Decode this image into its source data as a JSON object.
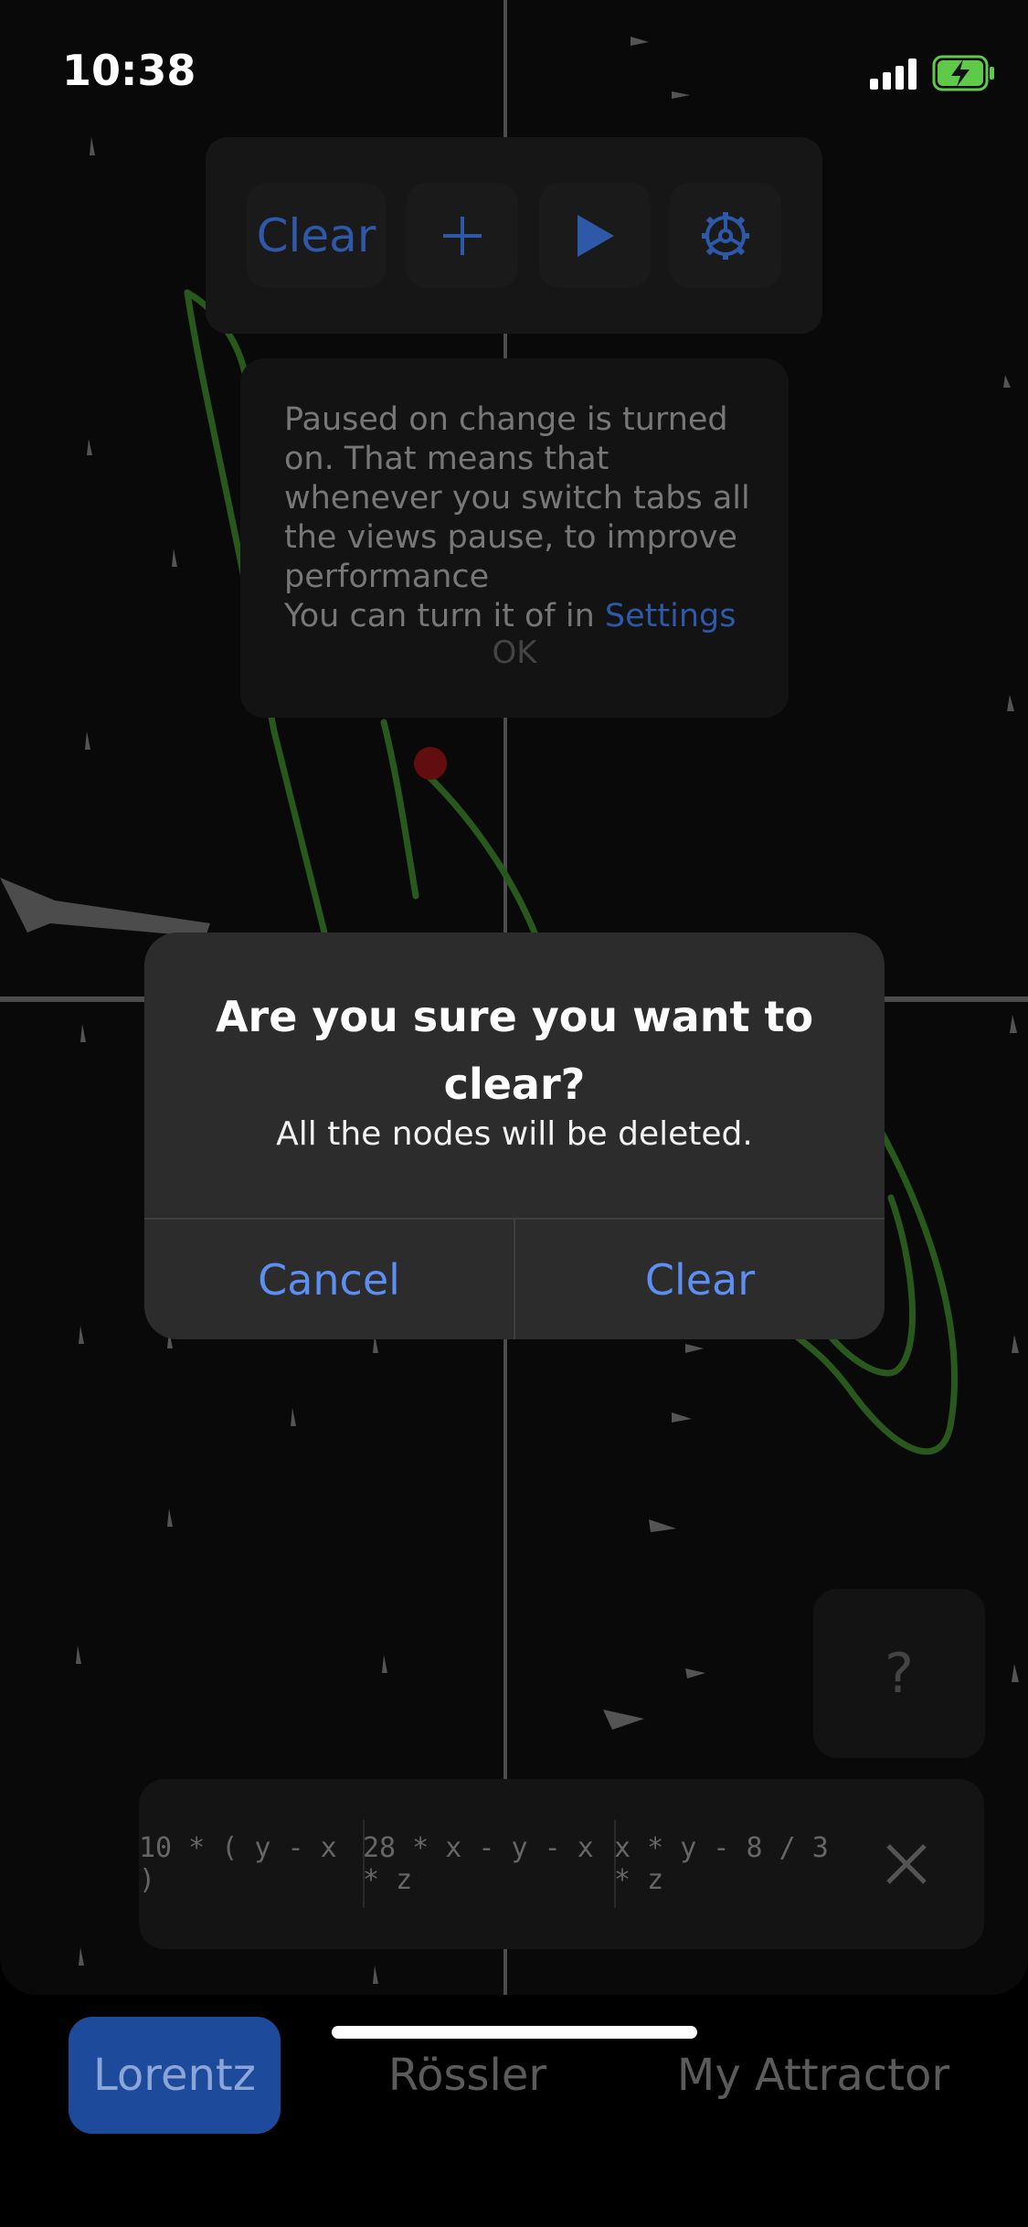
{
  "status_bar": {
    "time": "10:38",
    "signal_icon": "cellular-signal-icon",
    "battery_icon": "battery-charging-icon",
    "battery_color": "#5fc94a"
  },
  "toolbar": {
    "clear_label": "Clear",
    "add_icon": "plus-icon",
    "play_icon": "play-icon",
    "settings_icon": "gear-icon",
    "accent_color": "#2e59a8"
  },
  "notice": {
    "message": "Paused on change is turned on. That means that whenever you switch tabs all the views pause, to improve performance",
    "settings_prefix": "You can turn it of in ",
    "settings_link": "Settings",
    "ok_label": "OK"
  },
  "help": {
    "label": "?"
  },
  "equations": {
    "dx": "10 * ( y - x )",
    "dy": "28 * x - y - x * z",
    "dz": "x * y - 8 / 3 * z",
    "close_icon": "close-icon"
  },
  "alert": {
    "title": "Are you sure you want to clear?",
    "message": "All the nodes will be deleted.",
    "cancel_label": "Cancel",
    "confirm_label": "Clear",
    "button_color": "#5d8ef2"
  },
  "tabs": [
    {
      "label": "Lorentz",
      "selected": true
    },
    {
      "label": "Rössler",
      "selected": false
    },
    {
      "label": "My Attractor",
      "selected": false
    }
  ],
  "colors": {
    "trail": "#49a033",
    "node": "#b21b1b",
    "axis": "#8a8a8a",
    "selected_tab": "#1e4a9b"
  }
}
